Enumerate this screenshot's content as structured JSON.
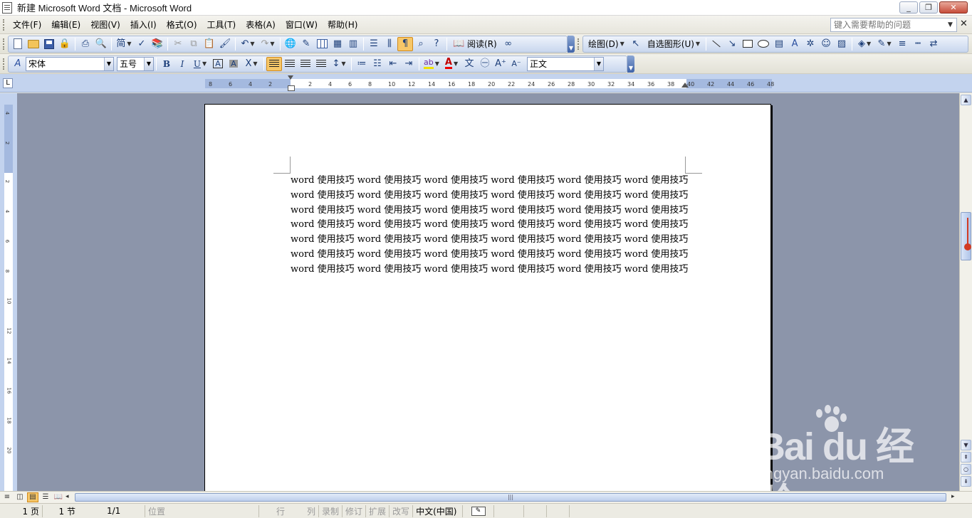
{
  "window": {
    "title": "新建 Microsoft Word 文档 - Microsoft Word",
    "minimize": "_",
    "restore": "❐",
    "close": "✕"
  },
  "menu": {
    "items": [
      "文件(F)",
      "编辑(E)",
      "视图(V)",
      "插入(I)",
      "格式(O)",
      "工具(T)",
      "表格(A)",
      "窗口(W)",
      "帮助(H)"
    ],
    "help_placeholder": "键入需要帮助的问题",
    "close_doc": "✕"
  },
  "toolbar1": {
    "read_label": "阅读(R)",
    "draw_label": "绘图(D)",
    "autoshape_label": "自选图形(U)"
  },
  "toolbar2": {
    "style_icon": "A",
    "font": "宋体",
    "size": "五号",
    "bold": "B",
    "italic": "I",
    "underline": "U",
    "style": "正文"
  },
  "ruler": {
    "corner": "L",
    "h_ticks": [
      "8",
      "6",
      "4",
      "2",
      "2",
      "4",
      "6",
      "8",
      "10",
      "12",
      "14",
      "16",
      "18",
      "20",
      "22",
      "24",
      "26",
      "28",
      "30",
      "32",
      "34",
      "36",
      "38",
      "40",
      "42",
      "44",
      "46",
      "48"
    ],
    "v_ticks": [
      "4",
      "2",
      "2",
      "4",
      "6",
      "8",
      "10",
      "12",
      "14",
      "16",
      "18",
      "20"
    ]
  },
  "document": {
    "lines": [
      "word 使用技巧 word 使用技巧 word 使用技巧 word 使用技巧 word 使用技巧 word 使用技巧",
      "word 使用技巧 word 使用技巧 word 使用技巧 word 使用技巧 word 使用技巧 word 使用技巧",
      "word 使用技巧 word 使用技巧 word 使用技巧 word 使用技巧 word 使用技巧 word 使用技巧",
      "word 使用技巧 word 使用技巧 word 使用技巧 word 使用技巧 word 使用技巧 word 使用技巧",
      "word 使用技巧 word 使用技巧 word 使用技巧 word 使用技巧 word 使用技巧 word 使用技巧",
      "word 使用技巧 word 使用技巧 word 使用技巧 word 使用技巧 word 使用技巧 word 使用技巧",
      "word 使用技巧 word 使用技巧 word 使用技巧 word 使用技巧 word 使用技巧 word 使用技巧"
    ]
  },
  "watermark": {
    "main": "Bai  du 经验",
    "sub": "jingyan.baidu.com"
  },
  "statusbar": {
    "page": "1 页",
    "section": "1 节",
    "page_of": "1/1",
    "position": "位置",
    "line": "行",
    "column": "列",
    "rec": "录制",
    "trk": "修订",
    "ext": "扩展",
    "ovr": "改写",
    "language": "中文(中国)"
  },
  "colors": {
    "doc_background": "#8c95aa",
    "ruler": "#c3d3ee",
    "active_button": "#f7c768",
    "font_color_a": "#c00000",
    "highlight": "#f0e000"
  }
}
